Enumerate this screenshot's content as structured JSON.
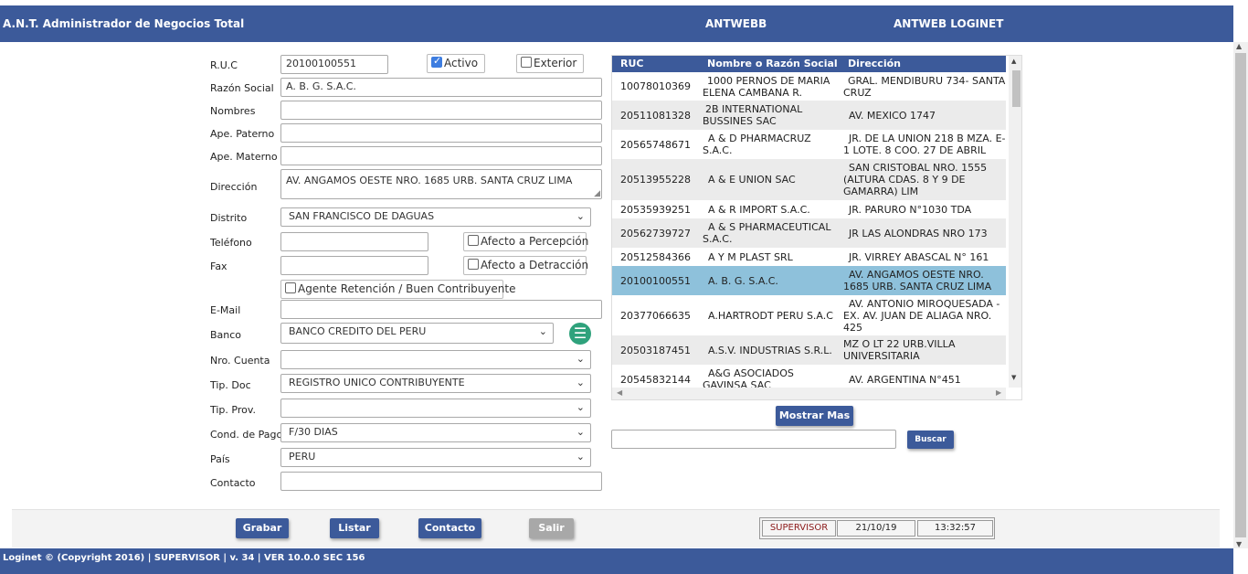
{
  "header": {
    "app_title": "A.N.T. Administrador de Negocios Total",
    "link1": "ANTWEBB",
    "link2": "ANTWEB LOGINET"
  },
  "form": {
    "ruc_label": "R.U.C",
    "ruc_value": "20100100551",
    "activo_label": "Activo",
    "activo_checked": true,
    "exterior_label": "Exterior",
    "razon_label": "Razón Social",
    "razon_value": "A. B. G. S.A.C.",
    "nombres_label": "Nombres",
    "nombres_value": "",
    "paterno_label": "Ape. Paterno",
    "paterno_value": "",
    "materno_label": "Ape. Materno",
    "materno_value": "",
    "direccion_label": "Dirección",
    "direccion_value": "AV. ANGAMOS OESTE NRO. 1685 URB. SANTA CRUZ LIMA",
    "distrito_label": "Distrito",
    "distrito_value": "SAN FRANCISCO DE DAGUAS",
    "telefono_label": "Teléfono",
    "telefono_value": "",
    "percepcion_label": "Afecto a Percepción",
    "fax_label": "Fax",
    "fax_value": "",
    "detraccion_label": "Afecto a Detracción",
    "agente_label": "Agente Retención / Buen Contribuyente",
    "email_label": "E-Mail",
    "email_value": "",
    "banco_label": "Banco",
    "banco_value": "BANCO CREDITO DEL PERU",
    "cuenta_label": "Nro. Cuenta",
    "cuenta_value": "",
    "tipdoc_label": "Tip. Doc",
    "tipdoc_value": "REGISTRO UNICO CONTRIBUYENTE",
    "tipprov_label": "Tip. Prov.",
    "tipprov_value": "",
    "condpago_label": "Cond. de Pago",
    "condpago_value": "F/30 DIAS",
    "pais_label": "País",
    "pais_value": "PERU",
    "contacto_label": "Contacto",
    "contacto_value": ""
  },
  "grid": {
    "headers": [
      "RUC",
      "Nombre o Razón Social",
      "Dirección"
    ],
    "rows": [
      {
        "ruc": "10078010369",
        "name": "1000 PERNOS DE MARIA ELENA CAMBANA R.",
        "dir": "GRAL. MENDIBURU 734- SANTA CRUZ"
      },
      {
        "ruc": "20511081328",
        "name": "2B INTERNATIONAL BUSSINES SAC",
        "dir": "AV. MEXICO 1747"
      },
      {
        "ruc": "20565748671",
        "name": "A & D PHARMACRUZ S.A.C.",
        "dir": "JR. DE LA UNION 218 B MZA. E-1 LOTE. 8 COO. 27 DE ABRIL"
      },
      {
        "ruc": "20513955228",
        "name": "A & E UNION SAC",
        "dir": "SAN CRISTOBAL NRO. 1555 (ALTURA CDAS. 8 Y 9 DE GAMARRA) LIM"
      },
      {
        "ruc": "20535939251",
        "name": "A & R IMPORT S.A.C.",
        "dir": "JR. PARURO N°1030 TDA"
      },
      {
        "ruc": "20562739727",
        "name": "A & S PHARMACEUTICAL S.A.C.",
        "dir": "JR LAS ALONDRAS NRO 173"
      },
      {
        "ruc": "20512584366",
        "name": "A Y M PLAST SRL",
        "dir": "JR. VIRREY ABASCAL N° 161"
      },
      {
        "ruc": "20100100551",
        "name": "A. B. G. S.A.C.",
        "dir": "AV. ANGAMOS OESTE NRO. 1685 URB. SANTA CRUZ LIMA"
      },
      {
        "ruc": "20377066635",
        "name": "A.HARTRODT PERU S.A.C",
        "dir": "AV. ANTONIO MIROQUESADA - EX. AV. JUAN DE ALIAGA NRO. 425"
      },
      {
        "ruc": "20503187451",
        "name": "A.S.V. INDUSTRIAS S.R.L.",
        "dir": "MZ O LT 22 URB.VILLA UNIVERSITARIA"
      },
      {
        "ruc": "20545832144",
        "name": "A&G ASOCIADOS GAVINSA SAC",
        "dir": "AV. ARGENTINA N°451"
      }
    ],
    "selected_index": 7,
    "more_button": "Mostrar Mas",
    "search_value": "",
    "search_button": "Buscar"
  },
  "actions": {
    "grabar": "Grabar",
    "listar": "Listar",
    "contacto": "Contacto",
    "salir": "Salir"
  },
  "status": {
    "user": "SUPERVISOR",
    "date": "21/10/19",
    "time": "13:32:57"
  },
  "footer": {
    "text": "Loginet © (Copyright 2016) | SUPERVISOR | v. 34 | VER 10.0.0 SEC 156"
  }
}
